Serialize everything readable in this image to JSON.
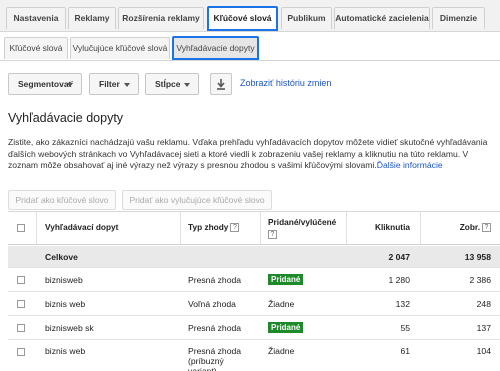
{
  "top_tabs": [
    "Nastavenia",
    "Reklamy",
    "Rozšírenia reklamy",
    "Kľúčové slová",
    "Publikum",
    "Automatické zacielenia",
    "Dimenzie"
  ],
  "sub_tabs": [
    "Kľúčové slová",
    "Vylučujúce kľúčové slová",
    "Vyhľadávacie dopyty"
  ],
  "toolbar": {
    "segment": "Segmentovať",
    "filter": "Filter",
    "columns": "Stĺpce",
    "download_icon": "download-icon",
    "history_link": "Zobraziť históriu zmien"
  },
  "page": {
    "title": "Vyhľadávacie dopyty",
    "description_line1": "Zistite, ako zákazníci nachádzajú vašu reklamu. Vďaka prehľadu vyhľadávacích dopytov môžete vidieť skutočné vyhľadávania",
    "description_line2": "ďalších webových stránkach vo Vyhľadávacej sieti a ktoré viedli k zobrazeniu vašej reklamy a kliknutiu na túto reklamu. V",
    "description_line3": "zoznam môže obsahovať aj iné výrazy než výrazy s presnou zhodou s vašimi kľúčovými slovami.",
    "more_info_link": "Ďalšie informácie"
  },
  "actions": {
    "add_keyword": "Pridať ako kľúčové slovo",
    "add_negative": "Pridať ako vylučujúce kľúčové slovo"
  },
  "table": {
    "headers": {
      "query": "Vyhľadávací dopyt",
      "match_type": "Typ zhody",
      "added_excluded": "Pridané/vylúčené",
      "clicks": "Kliknutia",
      "impressions": "Zobr."
    },
    "help_glyph": "?",
    "total": {
      "label": "Celkove",
      "clicks": "2 047",
      "impressions": "13 958"
    },
    "rows": [
      {
        "query": "biznisweb",
        "match": "Presná zhoda",
        "status": "Pridané",
        "status_badge": true,
        "clicks": "1 280",
        "impressions": "2 386"
      },
      {
        "query": "biznis web",
        "match": "Voľná zhoda",
        "status": "Žiadne",
        "status_badge": false,
        "clicks": "132",
        "impressions": "248"
      },
      {
        "query": "biznisweb sk",
        "match": "Presná zhoda",
        "status": "Pridané",
        "status_badge": true,
        "clicks": "55",
        "impressions": "137"
      },
      {
        "query": "biznis web",
        "match": "Presná zhoda (príbuzný variant)",
        "status": "Žiadne",
        "status_badge": false,
        "clicks": "61",
        "impressions": "104"
      }
    ]
  },
  "colors": {
    "accent_border": "#1a73e8",
    "link": "#1a55c8",
    "badge_green": "#1e8a2a"
  }
}
